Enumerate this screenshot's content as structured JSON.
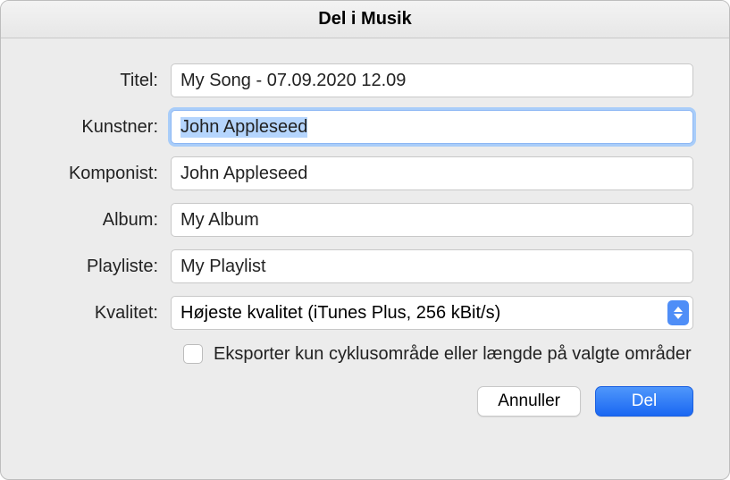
{
  "window": {
    "title": "Del i Musik"
  },
  "labels": {
    "title": "Titel:",
    "artist": "Kunstner:",
    "composer": "Komponist:",
    "album": "Album:",
    "playlist": "Playliste:",
    "quality": "Kvalitet:"
  },
  "fields": {
    "title": "My Song - 07.09.2020 12.09",
    "artist": "John Appleseed",
    "composer": "John Appleseed",
    "album": "My Album",
    "playlist": "My Playlist",
    "quality_selected": "Højeste kvalitet (iTunes Plus, 256 kBit/s)"
  },
  "checkbox": {
    "export_cycle_label": "Eksporter kun cyklusområde eller længde på valgte områder",
    "checked": false
  },
  "buttons": {
    "cancel": "Annuller",
    "share": "Del"
  }
}
